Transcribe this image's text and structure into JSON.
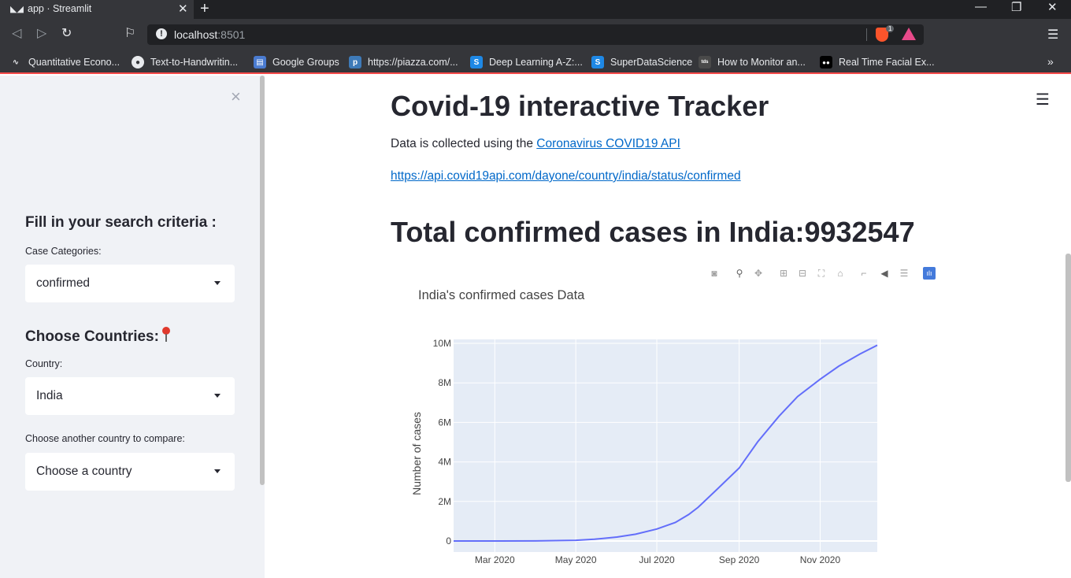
{
  "browser": {
    "tab_title": "app · Streamlit",
    "url_host": "localhost",
    "url_port": ":8501",
    "shield_count": "1",
    "bookmarks": [
      {
        "label": "Quantitative Econo...",
        "icon": "wave-icon",
        "color": "#35363a"
      },
      {
        "label": "Text-to-Handwritin...",
        "icon": "github-icon",
        "color": "#e8eaed"
      },
      {
        "label": "Google Groups",
        "icon": "groups-icon",
        "color": "#4a7bd0"
      },
      {
        "label": "https://piazza.com/...",
        "icon": "piazza-icon",
        "color": "#3e7ab8"
      },
      {
        "label": "Deep Learning A-Z:...",
        "icon": "sds-icon",
        "color": "#1e88e5"
      },
      {
        "label": "SuperDataScience",
        "icon": "sds-icon",
        "color": "#1e88e5"
      },
      {
        "label": "How to Monitor an...",
        "icon": "tds-icon",
        "color": "#4a4a4a"
      },
      {
        "label": "Real Time Facial Ex...",
        "icon": "medium-icon",
        "color": "#000000"
      }
    ]
  },
  "sidebar": {
    "search_heading": "Fill in your search criteria :",
    "case_label": "Case Categories:",
    "case_value": "confirmed",
    "countries_heading": "Choose Countries:",
    "country_label": "Country:",
    "country_value": "India",
    "compare_label": "Choose another country to compare:",
    "compare_value": "Choose a country"
  },
  "main": {
    "title": "Covid-19 interactive Tracker",
    "intro_text": "Data is collected using the ",
    "intro_link": "Coronavirus COVID19 API",
    "api_url": "https://api.covid19api.com/dayone/country/india/status/confirmed",
    "total_heading": "Total confirmed cases in India:9932547"
  },
  "chart_data": {
    "type": "line",
    "title": "India's confirmed cases Data",
    "xlabel": "",
    "ylabel": "Number of cases",
    "x_ticks": [
      "Mar 2020",
      "May 2020",
      "Jul 2020",
      "Sep 2020",
      "Nov 2020"
    ],
    "y_ticks": [
      "0",
      "2M",
      "4M",
      "6M",
      "8M",
      "10M"
    ],
    "ylim": [
      0,
      10000000
    ],
    "xlim": [
      "2020-01-30",
      "2020-12-14"
    ],
    "grid": true,
    "series": [
      {
        "color": "#636efa",
        "x": [
          "2020-01-30",
          "2020-03-01",
          "2020-04-01",
          "2020-05-01",
          "2020-05-15",
          "2020-06-01",
          "2020-06-15",
          "2020-07-01",
          "2020-07-15",
          "2020-07-25",
          "2020-08-01",
          "2020-08-15",
          "2020-09-01",
          "2020-09-15",
          "2020-10-01",
          "2020-10-15",
          "2020-11-01",
          "2020-11-15",
          "2020-12-01",
          "2020-12-14"
        ],
        "y": [
          1,
          3,
          1998,
          37257,
          85940,
          198706,
          343091,
          604641,
          936181,
          1336861,
          1695988,
          2589682,
          3691166,
          5020359,
          6312584,
          7307097,
          8184082,
          8845127,
          9462809,
          9906165
        ]
      }
    ]
  }
}
